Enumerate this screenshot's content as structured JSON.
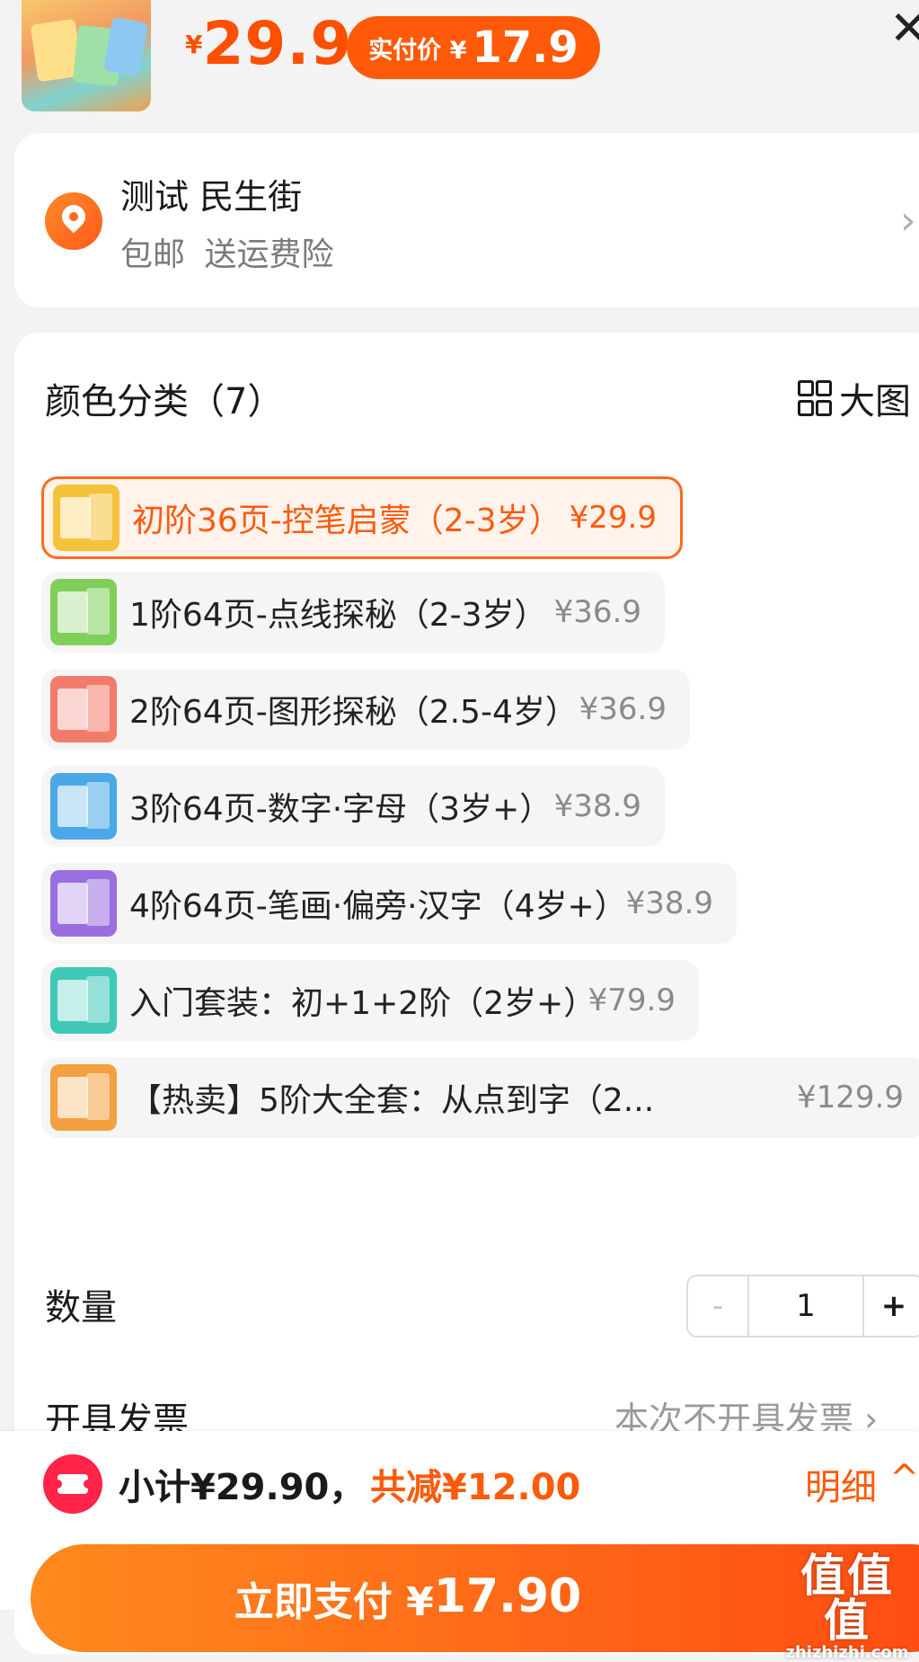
{
  "header": {
    "price_yen": "¥",
    "price": "29.9",
    "pay_label": "实付价 ¥",
    "pay_amount": "17.9"
  },
  "address": {
    "name": "测试 民生街",
    "sub": "包邮 送运费险"
  },
  "sku": {
    "title": "颜色分类（7）",
    "big_pic_label": "大图",
    "options": [
      {
        "label": "初阶36页-控笔启蒙（2-3岁）",
        "price": "¥29.9",
        "selected": true,
        "color": "#f4c23b"
      },
      {
        "label": "1阶64页-点线探秘（2-3岁）",
        "price": "¥36.9",
        "selected": false,
        "color": "#7fcf5a"
      },
      {
        "label": "2阶64页-图形探秘（2.5-4岁）",
        "price": "¥36.9",
        "selected": false,
        "color": "#f27b6b"
      },
      {
        "label": "3阶64页-数字·字母（3岁+）",
        "price": "¥38.9",
        "selected": false,
        "color": "#4aa8e8"
      },
      {
        "label": "4阶64页-笔画·偏旁·汉字（4岁+）",
        "price": "¥38.9",
        "selected": false,
        "color": "#9a6ee0"
      },
      {
        "label": "入门套装：初+1+2阶（2岁+）",
        "price": "¥79.9",
        "selected": false,
        "color": "#3fc9b6"
      },
      {
        "label": "【热卖】5阶大全套：从点到字（2...",
        "price": "¥129.9",
        "selected": false,
        "color": "#f2a040"
      }
    ]
  },
  "quantity": {
    "label": "数量",
    "minus": "-",
    "value": "1",
    "plus": "+"
  },
  "invoice": {
    "label": "开具发票",
    "value": "本次不开具发票 ›"
  },
  "footer": {
    "subtotal": "小计¥29.90，",
    "discount": "共减¥12.00",
    "detail": "明细",
    "detail_chevron": "^",
    "pay_label": "立即支付 ¥",
    "pay_amount": "17.90"
  },
  "watermark": {
    "line1": "值值值",
    "line2": "zhizhizhi.com"
  }
}
